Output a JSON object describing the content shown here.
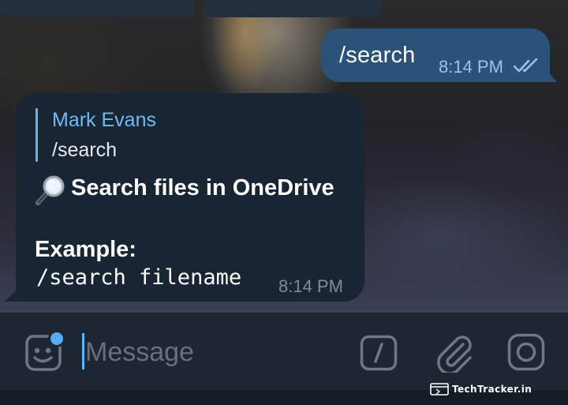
{
  "chat": {
    "outgoing": {
      "text": "/search",
      "time": "8:14 PM",
      "status_icon": "double-check-icon"
    },
    "incoming": {
      "reply_name": "Mark Evans",
      "reply_text": "/search",
      "title": "Search files in OneDrive",
      "title_icon": "magnifying-glass-icon",
      "example_label": "Example:",
      "example_code": "/search filename",
      "time": "8:14 PM"
    }
  },
  "composer": {
    "placeholder": "Message",
    "value": "",
    "icons": [
      "sticker-icon",
      "slash-command-icon",
      "paperclip-icon",
      "camera-icon"
    ]
  },
  "watermark": {
    "text": "TechTracker.in"
  },
  "colors": {
    "outgoing_bubble": "#2b5278",
    "incoming_bubble": "#182533",
    "accent": "#5eb5f7",
    "input_bar": "#1d2733"
  }
}
